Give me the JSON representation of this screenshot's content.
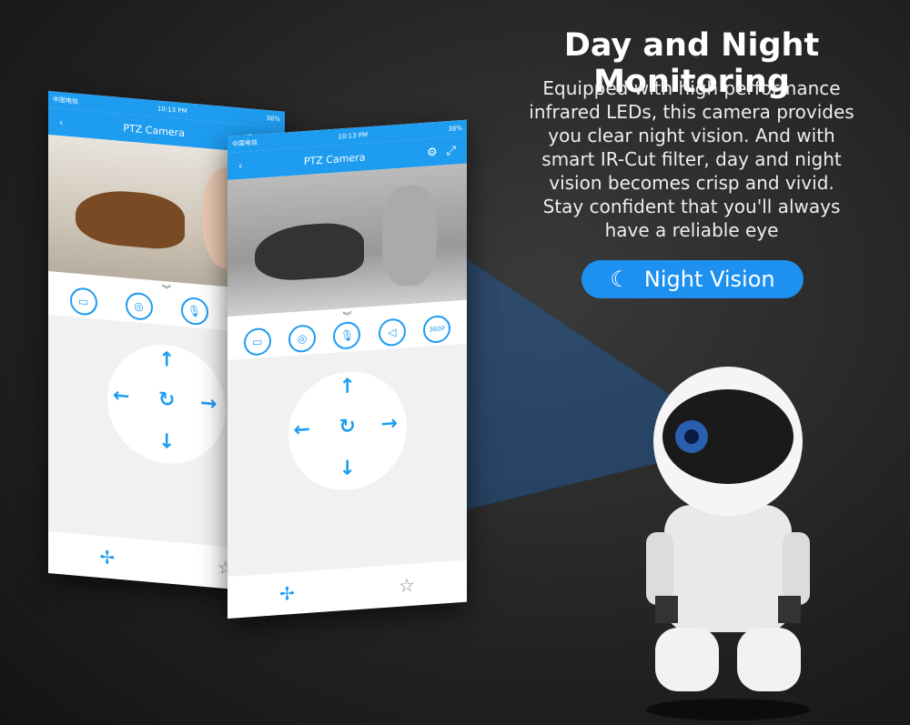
{
  "headline": "Day and Night Monitoring",
  "description": "Equipped with high performance infrared LEDs, this camera provides you clear night vision. And with smart IR-Cut filter, day and night vision becomes crisp and vivid. Stay confident that you'll always have a reliable eye",
  "badge": {
    "label": "Night Vision",
    "icon": "moon-stars-icon"
  },
  "phones": [
    {
      "carrier": "中国电信",
      "time": "10:13 PM",
      "battery": "38%",
      "title": "PTZ Camera",
      "quality": ""
    },
    {
      "carrier": "中国电信",
      "time": "10:13 PM",
      "battery": "38%",
      "title": "PTZ Camera",
      "quality": "360P"
    }
  ],
  "colors": {
    "accent": "#1e9cf0",
    "badge": "#1e90f0"
  }
}
